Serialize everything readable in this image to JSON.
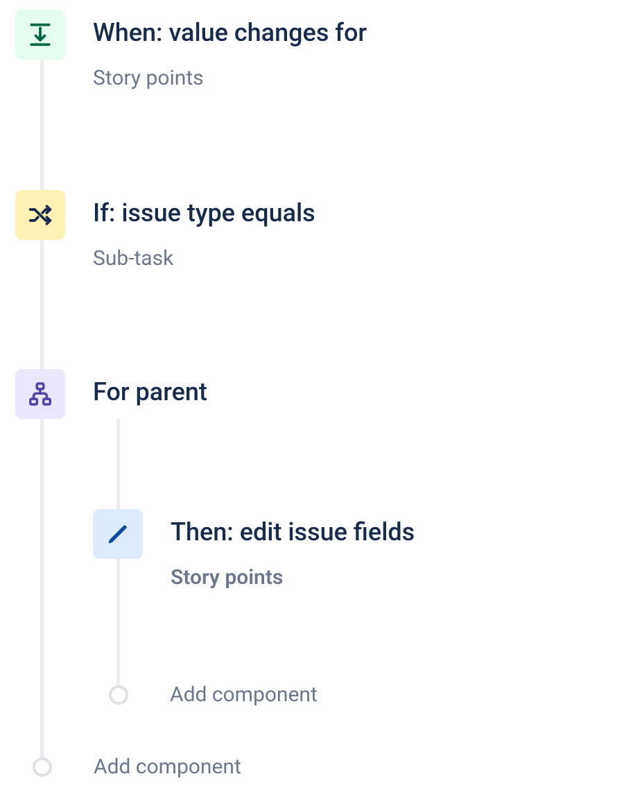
{
  "trigger": {
    "title": "When: value changes for",
    "sub": "Story points"
  },
  "condition": {
    "title": "If: issue type equals",
    "sub": "Sub-task"
  },
  "branch": {
    "title": "For parent"
  },
  "action": {
    "title": "Then: edit issue fields",
    "sub": "Story points"
  },
  "add_inner": "Add component",
  "add_outer": "Add component"
}
